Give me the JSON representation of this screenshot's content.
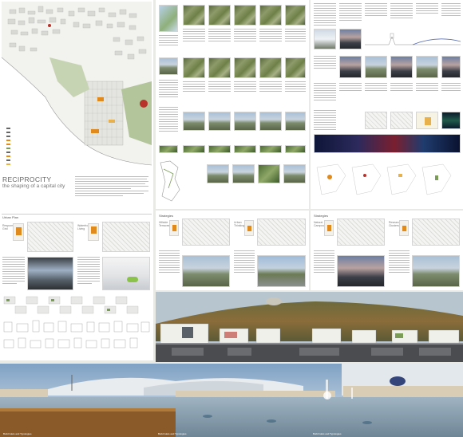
{
  "poster1": {
    "title": "RECIPROCITY",
    "subtitle": "the shaping of a capital city",
    "sections": [
      "Urban Plan"
    ],
    "captions": [
      "Responsive Grid",
      "Waterfront Living"
    ]
  },
  "poster2": {
    "sections": [
      "Strategies"
    ],
    "captions": [
      "Hillside Terraces",
      "Urban Thinking"
    ]
  },
  "poster3": {
    "sections": [
      "Strategies"
    ],
    "captions": [
      "Natural Campus",
      "Research Clusters"
    ]
  },
  "footer": {
    "left": "Build Islets and Typologies",
    "mid": "Build Islets and Typologies",
    "right": "Build Islets and Typologies"
  },
  "colors": {
    "accent": "#e08a1e",
    "red": "#b8312a",
    "green": "#7a9c56"
  }
}
